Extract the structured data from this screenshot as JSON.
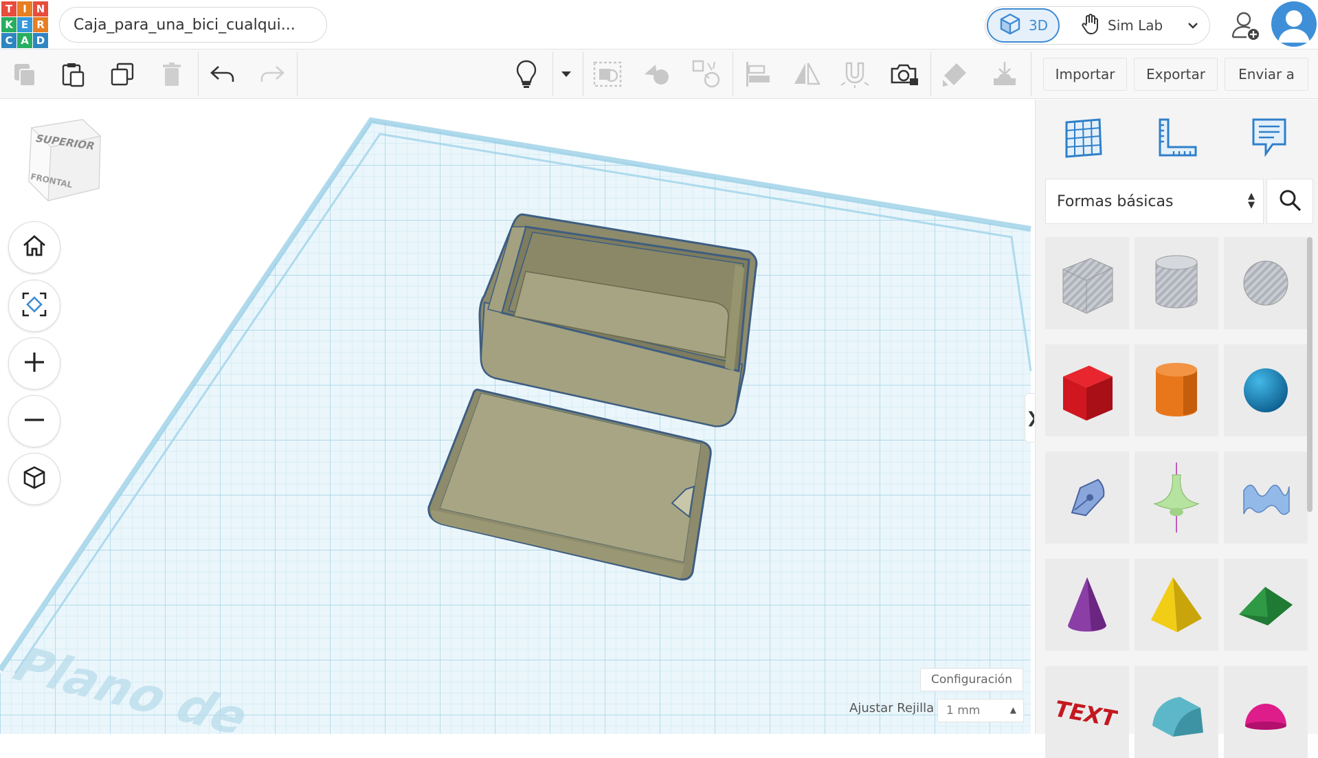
{
  "app": {
    "logo_letters": [
      "T",
      "I",
      "N",
      "K",
      "E",
      "R",
      "C",
      "A",
      "D"
    ],
    "logo_colors": [
      "#e74c3c",
      "#e67e22",
      "#e74c3c",
      "#27ae60",
      "#3498db",
      "#e67e22",
      "#2e86c1",
      "#27ae60",
      "#2e86c1"
    ]
  },
  "header": {
    "design_title": "Caja_para_una_bici_cualqui...",
    "mode_3d_label": "3D",
    "sim_lab_label": "Sim Lab"
  },
  "toolbar": {
    "icons": [
      "copy-icon",
      "paste-icon",
      "duplicate-icon",
      "delete-icon",
      "undo-icon",
      "redo-icon",
      "lightbulb-icon",
      "dropdown-caret-icon",
      "group-icon",
      "ungroup-icon",
      "hole-icon",
      "align-icon",
      "mirror-icon",
      "magnet-icon",
      "ruler-camera-icon",
      "paint-icon",
      "drop-icon"
    ],
    "import_label": "Importar",
    "export_label": "Exportar",
    "send_label": "Enviar a"
  },
  "viewcube": {
    "top_label": "SUPERIOR",
    "front_label": "FRONTAL"
  },
  "workplane": {
    "watermark": "Plano de",
    "settings_label": "Configuración",
    "snap_label": "Ajustar Rejilla",
    "snap_value": "1 mm"
  },
  "panel": {
    "category": "Formas básicas",
    "shapes": [
      {
        "name": "box-hole",
        "color": "#b8bcc4"
      },
      {
        "name": "cylinder-hole",
        "color": "#b8bcc4"
      },
      {
        "name": "sphere-hole",
        "color": "#b8bcc4"
      },
      {
        "name": "box",
        "color": "#d0161f"
      },
      {
        "name": "cylinder",
        "color": "#e8761a"
      },
      {
        "name": "sphere",
        "color": "#1a8fc6"
      },
      {
        "name": "scribble",
        "color": "#8aa7dc"
      },
      {
        "name": "paraboloid",
        "color": "#b6e3a0"
      },
      {
        "name": "wave",
        "color": "#93b9e8"
      },
      {
        "name": "cone",
        "color": "#8b3ea6"
      },
      {
        "name": "pyramid",
        "color": "#f2cd16"
      },
      {
        "name": "roof",
        "color": "#2f9a45"
      },
      {
        "name": "text",
        "color": "#c41820"
      },
      {
        "name": "half-cylinder",
        "color": "#5cb8c8"
      },
      {
        "name": "half-sphere",
        "color": "#de1d8b"
      }
    ]
  }
}
